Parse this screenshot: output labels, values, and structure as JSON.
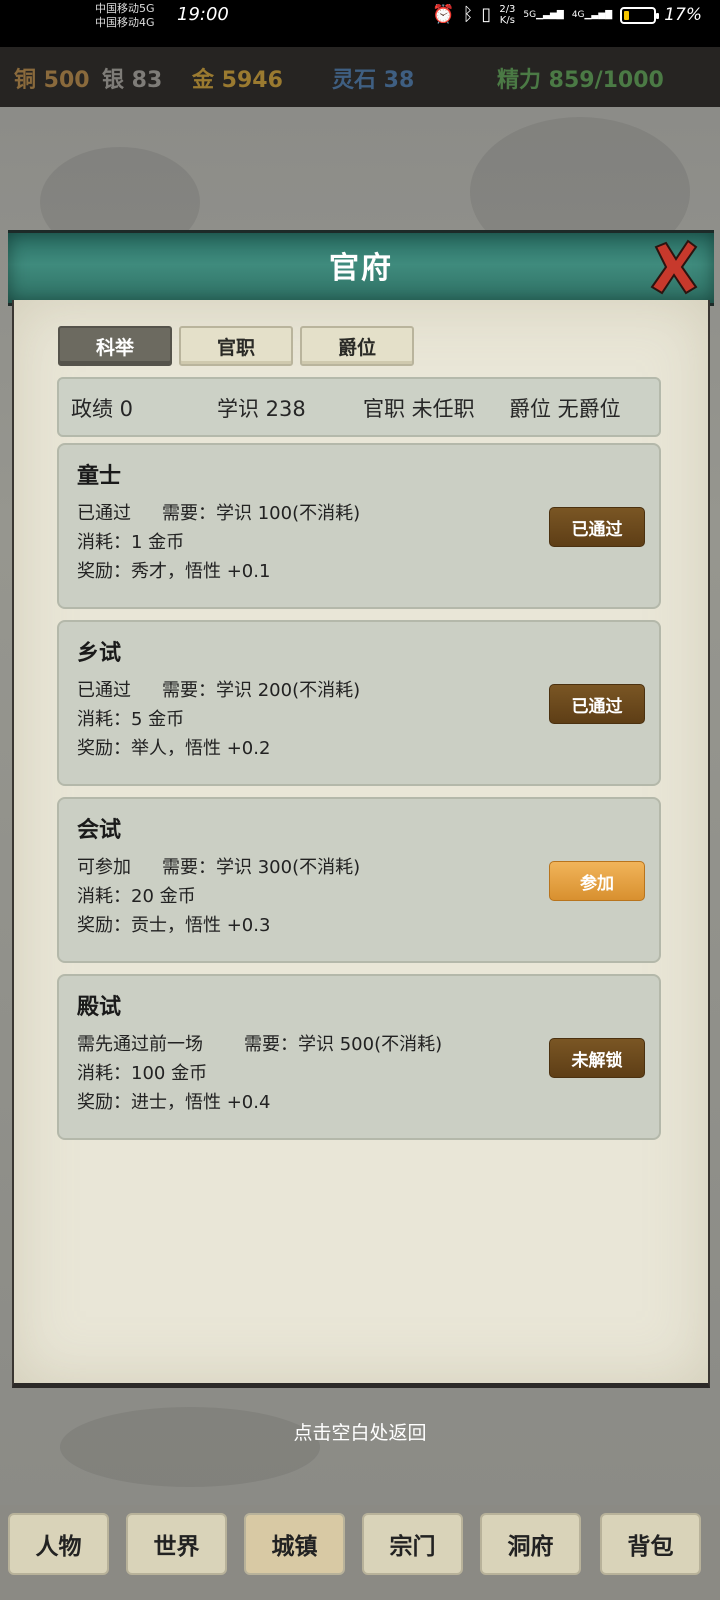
{
  "status_bar": {
    "carrier_1": "中国移动5G",
    "carrier_2": "中国移动4G",
    "time": "19:00",
    "net_speed_value": "2/3",
    "net_speed_unit": "K/s",
    "signal_1_label": "5G",
    "signal_2_label": "4G",
    "battery_percent": "17%",
    "battery_level": 0.17,
    "battery_color": "#f5c400"
  },
  "resources": [
    {
      "label": "铜 500",
      "color": "#8a6a3c"
    },
    {
      "label": "银 83",
      "color": "#7e7c78"
    },
    {
      "label": "金 5946",
      "color": "#9a7a30"
    },
    {
      "label": "灵石 38",
      "color": "#3f5f82"
    },
    {
      "label": "精力 859/1000",
      "color": "#4b7a45"
    }
  ],
  "dialog": {
    "title": "官府",
    "close_icon": "close-x-icon",
    "tabs": [
      {
        "label": "科举",
        "active": true
      },
      {
        "label": "官职",
        "active": false
      },
      {
        "label": "爵位",
        "active": false
      }
    ],
    "stats": {
      "merit": "政绩 0",
      "knowledge": "学识 238",
      "office": "官职 未任职",
      "title": "爵位 无爵位"
    },
    "exams": [
      {
        "name": "童士",
        "status": "已通过",
        "need": "需要：学识 100(不消耗)",
        "cost": "消耗：1 金币",
        "reward": "奖励：秀才，悟性 +0.1",
        "button": "已通过",
        "button_state": "passed"
      },
      {
        "name": "乡试",
        "status": "已通过",
        "need": "需要：学识 200(不消耗)",
        "cost": "消耗：5 金币",
        "reward": "奖励：举人，悟性 +0.2",
        "button": "已通过",
        "button_state": "passed"
      },
      {
        "name": "会试",
        "status": "可参加",
        "need": "需要：学识 300(不消耗)",
        "cost": "消耗：20 金币",
        "reward": "奖励：贡士，悟性 +0.3",
        "button": "参加",
        "button_state": "available"
      },
      {
        "name": "殿试",
        "status": "需先通过前一场",
        "need": "需要：学识 500(不消耗)",
        "cost": "消耗：100 金币",
        "reward": "奖励：进士，悟性 +0.4",
        "button": "未解锁",
        "button_state": "locked"
      }
    ]
  },
  "hint": "点击空白处返回",
  "bottom_nav": [
    {
      "label": "人物",
      "active": false
    },
    {
      "label": "世界",
      "active": false
    },
    {
      "label": "城镇",
      "active": true
    },
    {
      "label": "宗门",
      "active": false
    },
    {
      "label": "洞府",
      "active": false
    },
    {
      "label": "背包",
      "active": false
    }
  ]
}
